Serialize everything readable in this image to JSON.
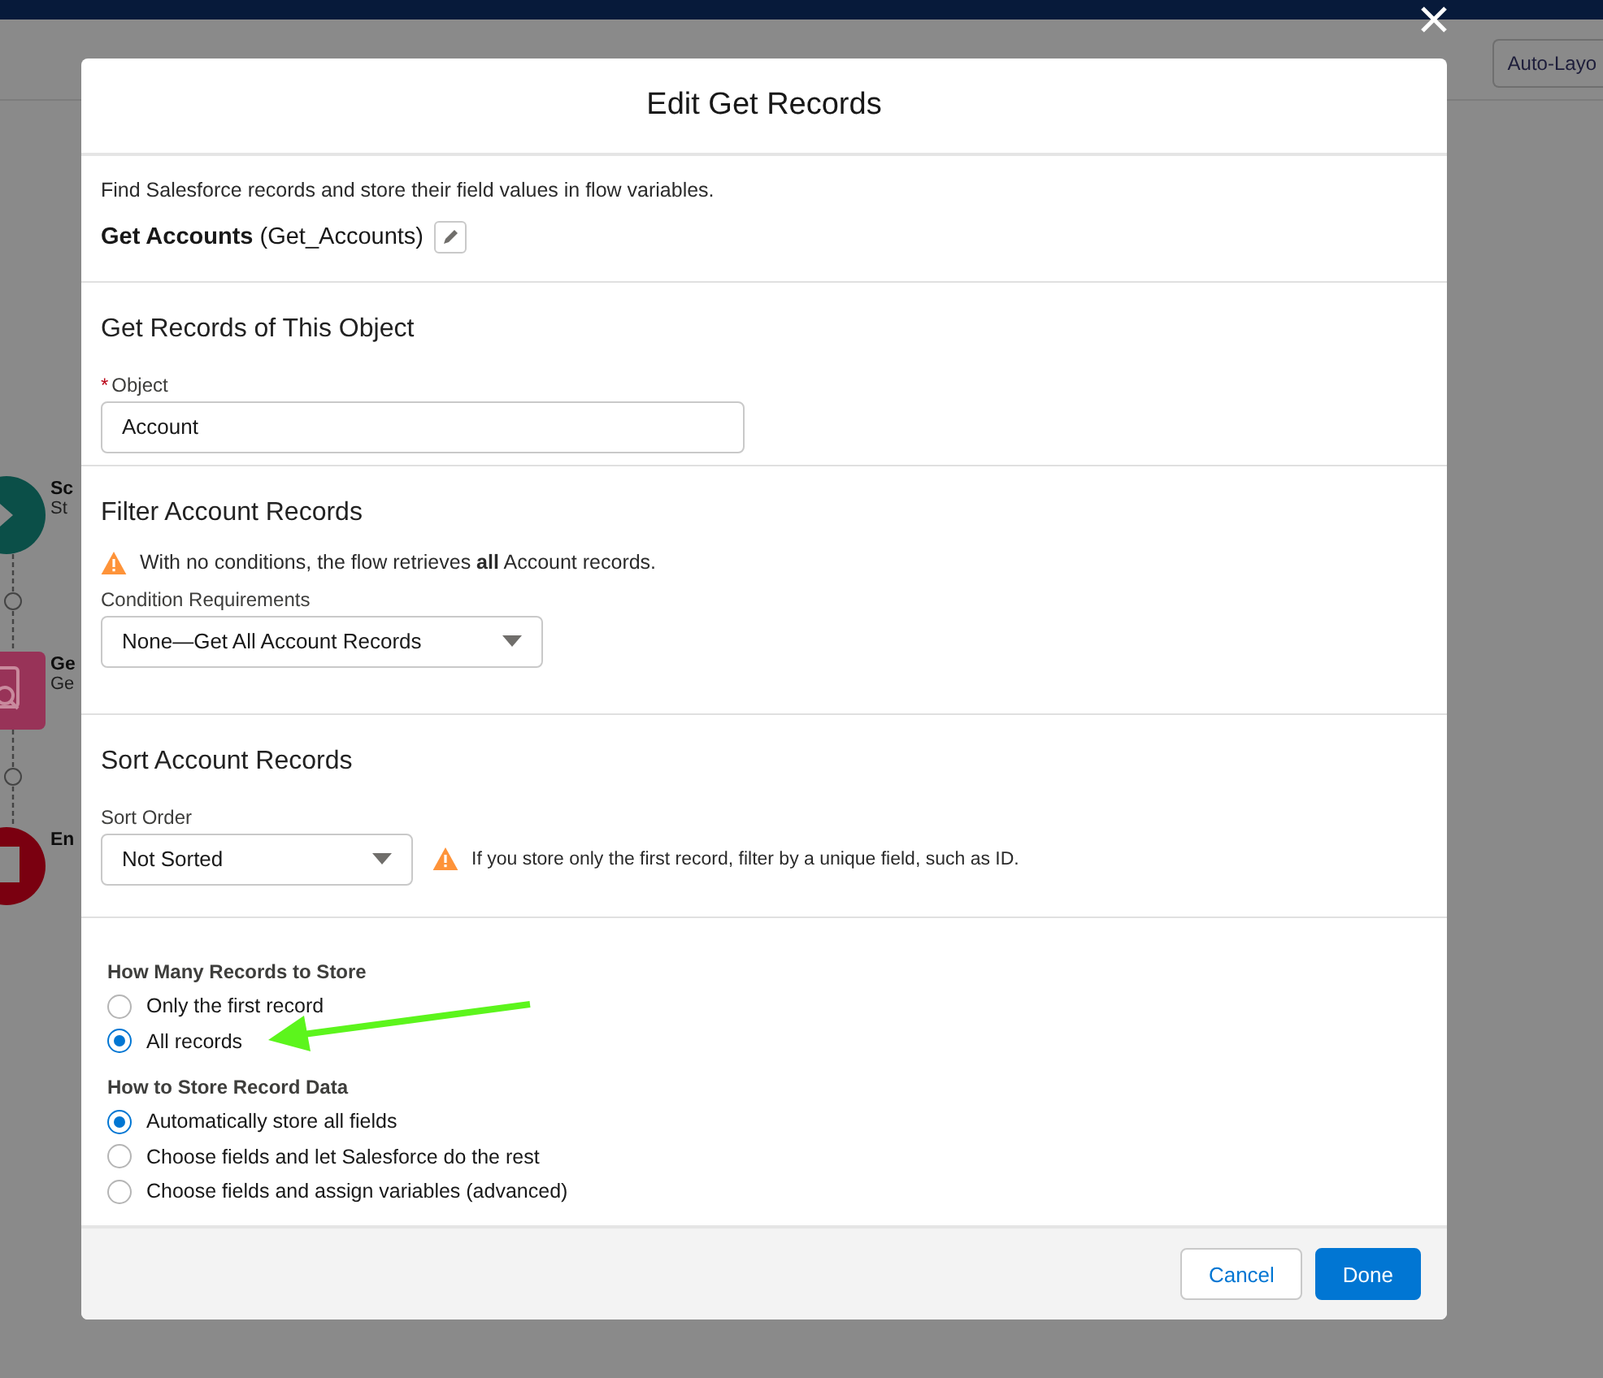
{
  "toolbar": {
    "layout_button": "Auto-Layo"
  },
  "canvas_nodes": [
    {
      "kind": "start",
      "title": "Sc",
      "subtitle": "St"
    },
    {
      "kind": "get",
      "title": "Ge",
      "subtitle": "Ge"
    },
    {
      "kind": "end",
      "title": "En"
    }
  ],
  "modal": {
    "title": "Edit Get Records",
    "description": "Find Salesforce records and store their field values in flow variables.",
    "element_label": "Get Accounts",
    "api_name": "(Get_Accounts)",
    "object_section": {
      "heading": "Get Records of This Object",
      "label": "Object",
      "required_mark": "*",
      "value": "Account"
    },
    "filter_section": {
      "heading": "Filter Account Records",
      "warning": "With no conditions, the flow retrieves **all** Account records.",
      "label": "Condition Requirements",
      "value": "None—Get All Account Records"
    },
    "sort_section": {
      "heading": "Sort Account Records",
      "label": "Sort Order",
      "value": "Not Sorted",
      "warning": "If you store only the first record, filter by a unique field, such as ID."
    },
    "radio_groups": [
      {
        "label": "How Many Records to Store",
        "options": [
          {
            "label": "Only the first record",
            "selected": false
          },
          {
            "label": "All records",
            "selected": true
          }
        ]
      },
      {
        "label": "How to Store Record Data",
        "options": [
          {
            "label": "Automatically store all fields",
            "selected": true
          },
          {
            "label": "Choose fields and let Salesforce do the rest",
            "selected": false
          },
          {
            "label": "Choose fields and assign variables (advanced)",
            "selected": false
          }
        ]
      }
    ],
    "buttons": [
      {
        "label": "Cancel",
        "kind": "neutral"
      },
      {
        "label": "Done",
        "kind": "brand"
      }
    ]
  }
}
